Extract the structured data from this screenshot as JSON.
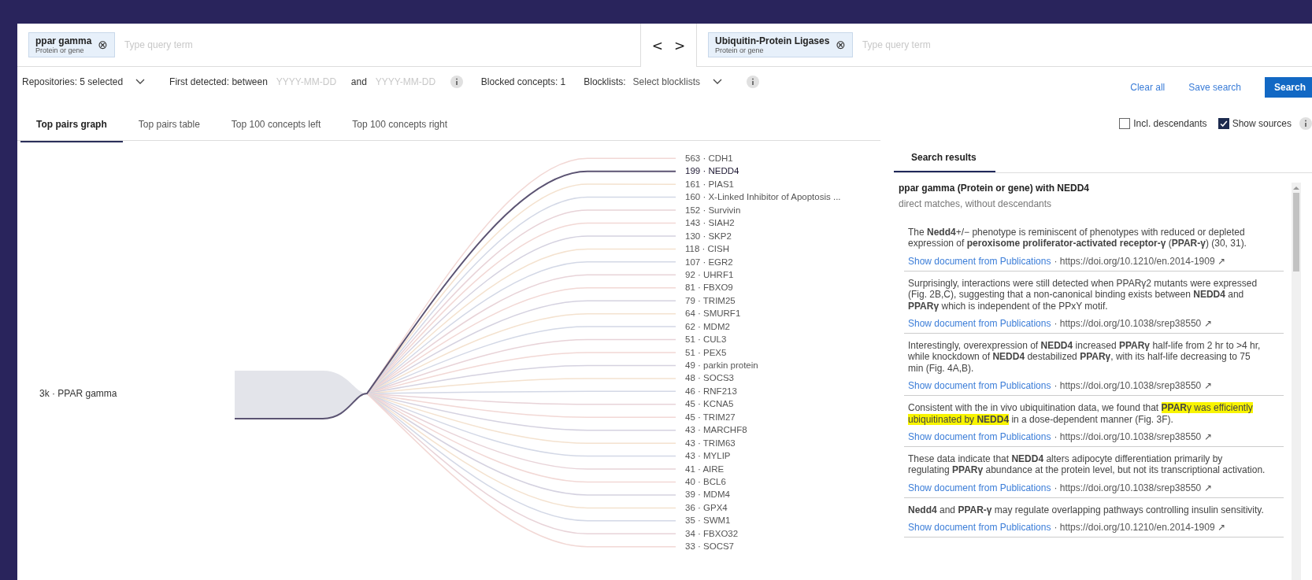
{
  "query_left": {
    "chips": [
      {
        "term": "ppar gamma",
        "type": "Protein or gene",
        "close": "⊗"
      }
    ],
    "placeholder": "Type query term"
  },
  "nav": [
    "<",
    ">"
  ],
  "query_right": {
    "chips": [
      {
        "term": "Ubiquitin-Protein Ligases",
        "type": "Protein or gene",
        "close": "⊗"
      }
    ],
    "placeholder": "Type query term"
  },
  "filters": {
    "repositories": "Repositories: 5 selected",
    "first_detected": "First detected: between",
    "date_from": {
      "placeholder": "YYYY-MM-DD"
    },
    "and": "and",
    "date_to": {
      "placeholder": "YYYY-MM-DD"
    },
    "blocked": "Blocked concepts: 1",
    "blocklists_label": "Blocklists:",
    "blocklists_select": "Select blocklists"
  },
  "actions": {
    "clear": "Clear all",
    "save": "Save search",
    "search": "Search"
  },
  "tabs": [
    {
      "label": "Top pairs graph",
      "selected": true
    },
    {
      "label": "Top pairs table",
      "selected": false
    },
    {
      "label": "Top 100 concepts left",
      "selected": false
    },
    {
      "label": "Top 100 concepts right",
      "selected": false
    }
  ],
  "options": [
    {
      "label": "Incl. descendants",
      "checked": false
    },
    {
      "label": "Show sources",
      "checked": true
    }
  ],
  "graph": {
    "source": "3k · PPAR gamma",
    "concepts": [
      {
        "label": "563 · CDH1",
        "selected": false
      },
      {
        "label": "199 · NEDD4",
        "selected": true
      },
      {
        "label": "161 · PIAS1",
        "selected": false
      },
      {
        "label": "160 · X-Linked Inhibitor of Apoptosis ...",
        "selected": false
      },
      {
        "label": "152 · Survivin",
        "selected": false
      },
      {
        "label": "143 · SIAH2",
        "selected": false
      },
      {
        "label": "130 · SKP2",
        "selected": false
      },
      {
        "label": "118 · CISH",
        "selected": false
      },
      {
        "label": "107 · EGR2",
        "selected": false
      },
      {
        "label": "92 · UHRF1",
        "selected": false
      },
      {
        "label": "81 · FBXO9",
        "selected": false
      },
      {
        "label": "79 · TRIM25",
        "selected": false
      },
      {
        "label": "64 · SMURF1",
        "selected": false
      },
      {
        "label": "62 · MDM2",
        "selected": false
      },
      {
        "label": "51 · CUL3",
        "selected": false
      },
      {
        "label": "51 · PEX5",
        "selected": false
      },
      {
        "label": "49 · parkin protein",
        "selected": false
      },
      {
        "label": "48 · SOCS3",
        "selected": false
      },
      {
        "label": "46 · RNF213",
        "selected": false
      },
      {
        "label": "45 · KCNA5",
        "selected": false
      },
      {
        "label": "45 · TRIM27",
        "selected": false
      },
      {
        "label": "43 · MARCHF8",
        "selected": false
      },
      {
        "label": "43 · TRIM63",
        "selected": false
      },
      {
        "label": "43 · MYLIP",
        "selected": false
      },
      {
        "label": "41 · AIRE",
        "selected": false
      },
      {
        "label": "40 · BCL6",
        "selected": false
      },
      {
        "label": "39 · MDM4",
        "selected": false
      },
      {
        "label": "36 · GPX4",
        "selected": false
      },
      {
        "label": "35 · SWM1",
        "selected": false
      },
      {
        "label": "34 · FBXO32",
        "selected": false
      },
      {
        "label": "33 · SOCS7",
        "selected": false
      }
    ]
  },
  "results": {
    "tab": {
      "label": "Search results",
      "selected": true
    },
    "title": "ppar gamma (Protein or gene) with NEDD4",
    "subtitle": "direct matches, without descendants",
    "snippets": [
      {
        "parts": [
          {
            "text": "The **Nedd4**+/− phenotype is reminiscent of phenotypes with reduced or depleted expression of **peroxisome proliferator-activated receptor-γ** (**PPAR-γ**) (30, 31).",
            "highlight": false
          }
        ],
        "link": "Show document from Publications",
        "source": "· https://doi.org/10.1210/en.2014-1909 ↗"
      },
      {
        "parts": [
          {
            "text": "Surprisingly, interactions were still detected when PPARγ2 mutants were expressed (Fig. 2B,C), suggesting that a non-canonical binding exists between **NEDD4** and **PPARγ** which is independent of the PPxY motif.",
            "highlight": false
          }
        ],
        "link": "Show document from Publications",
        "source": "· https://doi.org/10.1038/srep38550 ↗"
      },
      {
        "parts": [
          {
            "text": "Interestingly, overexpression of **NEDD4** increased **PPARγ** half-life from 2 hr to >4 hr, while knockdown of **NEDD4** destabilized **PPARγ**, with its half-life decreasing to 75 min (Fig. 4A,B).",
            "highlight": false
          }
        ],
        "link": "Show document from Publications",
        "source": "· https://doi.org/10.1038/srep38550 ↗"
      },
      {
        "parts": [
          {
            "text": "Consistent with the in vivo ubiquitination data, we found that ",
            "highlight": false
          },
          {
            "text": "**PPAR**γ was efficiently ubiquitinated by **NEDD4**",
            "highlight": true
          },
          {
            "text": " in a dose-dependent manner (Fig. 3F).",
            "highlight": false
          }
        ],
        "link": "Show document from Publications",
        "source": "· https://doi.org/10.1038/srep38550 ↗"
      },
      {
        "parts": [
          {
            "text": "These data indicate that **NEDD4** alters adipocyte differentiation primarily by regulating **PPARγ** abundance at the protein level, but not its transcriptional activation.",
            "highlight": false
          }
        ],
        "link": "Show document from Publications",
        "source": "· https://doi.org/10.1038/srep38550 ↗"
      },
      {
        "parts": [
          {
            "text": "**Nedd4** and **PPAR-γ** may regulate overlapping pathways controlling insulin sensitivity.",
            "highlight": false
          }
        ],
        "link": "Show document from Publications",
        "source": "· https://doi.org/10.1210/en.2014-1909 ↗"
      }
    ]
  }
}
